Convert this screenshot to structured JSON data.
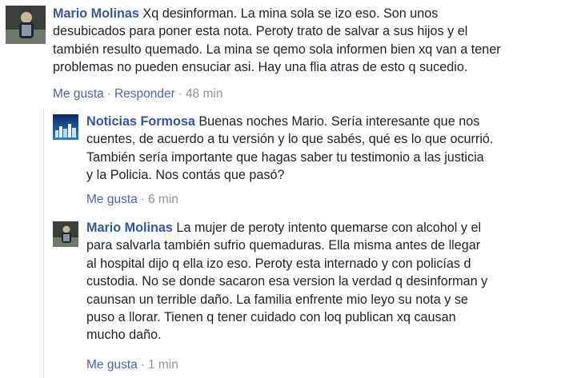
{
  "comments": [
    {
      "author": "Mario Molinas",
      "avatar_icon": "user-photo-icon",
      "lines": [
        " Xq desinforman. La mina sola se izo eso. Son unos",
        "desubicados para poner esta nota. Peroty trato de salvar a sus hijos y el",
        "también resulto quemado. La mina se qemo sola informen bien xq van a tener",
        "problemas no pueden ensuciar asi. Hay una flia atras de esto q sucedio."
      ],
      "like_label": "Me gusta",
      "reply_label": "Responder",
      "time": "48 min"
    },
    {
      "author": "Noticias Formosa",
      "avatar_icon": "page-logo-icon",
      "lines": [
        " Buenas noches Mario. Sería interesante que nos",
        "cuentes, de acuerdo a tu versión y lo que sabés, qué es lo que ocurrió.",
        "También sería importante que hagas saber tu testimonio a las justicia",
        "y la Policia. Nos contás que pasó?"
      ],
      "like_label": "Me gusta",
      "time": "6 min"
    },
    {
      "author": "Mario Molinas",
      "avatar_icon": "user-photo-icon",
      "lines": [
        " La mujer de peroty intento quemarse con alcohol y el",
        "para salvarla también sufrio quemaduras. Ella misma antes de llegar",
        "al hospital dijo q ella izo eso. Peroty esta internado y con policías d",
        "custodia. No se donde sacaron esa version la verdad q desinforman y",
        "caunsan un terrible daño. La familia enfrente mio leyo su nota y se",
        "puso a llorar. Tienen q tener cuidado con loq publican xq causan",
        "mucho daño."
      ],
      "like_label": "Me gusta",
      "time": "1 min"
    }
  ],
  "separator": "·"
}
